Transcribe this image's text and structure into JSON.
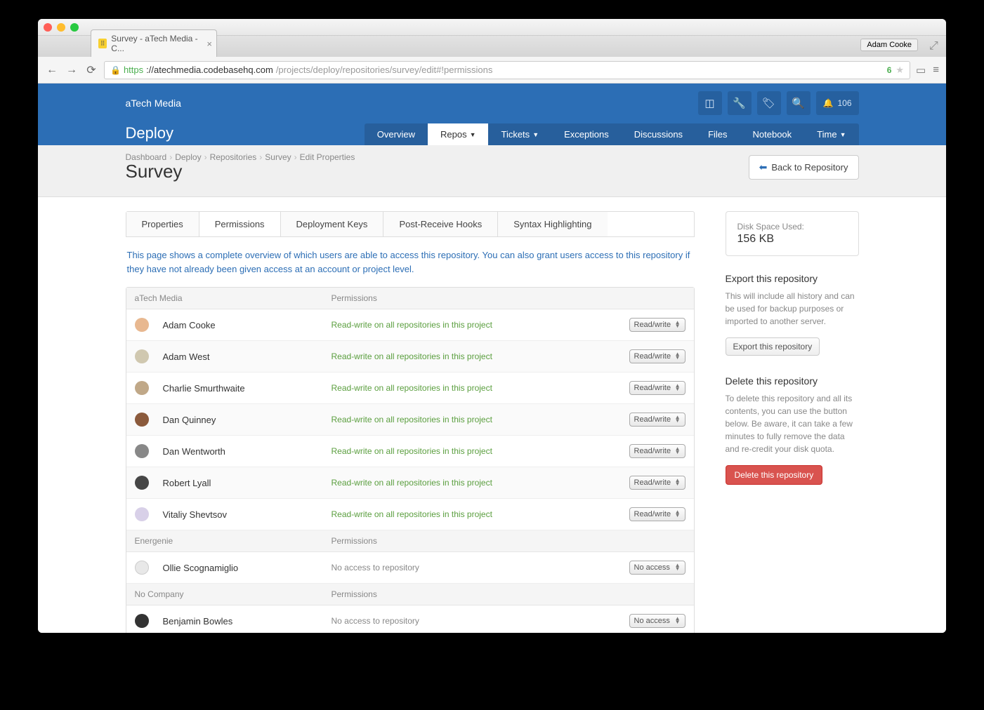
{
  "browser": {
    "tab_title": "Survey - aTech Media - C...",
    "profile": "Adam Cooke",
    "url_scheme": "https",
    "url_host": "://atechmedia.codebasehq.com",
    "url_path": "/projects/deploy/repositories/survey/edit#!permissions",
    "ext_badge": "6"
  },
  "header": {
    "org": "aTech Media",
    "project": "Deploy",
    "notif_count": "106",
    "nav": [
      {
        "label": "Overview"
      },
      {
        "label": "Repos",
        "caret": true,
        "active": true
      },
      {
        "label": "Tickets",
        "caret": true
      },
      {
        "label": "Exceptions"
      },
      {
        "label": "Discussions"
      },
      {
        "label": "Files"
      },
      {
        "label": "Notebook"
      },
      {
        "label": "Time",
        "caret": true
      }
    ]
  },
  "breadcrumbs": [
    "Dashboard",
    "Deploy",
    "Repositories",
    "Survey",
    "Edit Properties"
  ],
  "page_title": "Survey",
  "back_button": "Back to Repository",
  "subtabs": [
    {
      "label": "Properties"
    },
    {
      "label": "Permissions",
      "active": true
    },
    {
      "label": "Deployment Keys"
    },
    {
      "label": "Post-Receive Hooks"
    },
    {
      "label": "Syntax Highlighting"
    }
  ],
  "description": "This page shows a complete overview of which users are able to access this repository. You can also grant users access to this repository if they have not already been given access at an account or project level.",
  "columns": {
    "user": "",
    "perm": "Permissions"
  },
  "groups": [
    {
      "name": "aTech Media",
      "users": [
        {
          "name": "Adam Cooke",
          "perm": "Read-write on all repositories in this project",
          "sel": "Read/write",
          "avatar": "#e8b890"
        },
        {
          "name": "Adam West",
          "perm": "Read-write on all repositories in this project",
          "sel": "Read/write",
          "alt": true,
          "avatar": "#d0c8b0"
        },
        {
          "name": "Charlie Smurthwaite",
          "perm": "Read-write on all repositories in this project",
          "sel": "Read/write",
          "avatar": "#c0a888"
        },
        {
          "name": "Dan Quinney",
          "perm": "Read-write on all repositories in this project",
          "sel": "Read/write",
          "alt": true,
          "avatar": "#8b5a3c"
        },
        {
          "name": "Dan Wentworth",
          "perm": "Read-write on all repositories in this project",
          "sel": "Read/write",
          "avatar": "#888"
        },
        {
          "name": "Robert Lyall",
          "perm": "Read-write on all repositories in this project",
          "sel": "Read/write",
          "alt": true,
          "avatar": "#464646"
        },
        {
          "name": "Vitaliy Shevtsov",
          "perm": "Read-write on all repositories in this project",
          "sel": "Read/write",
          "avatar": "#d8d0e8"
        }
      ]
    },
    {
      "name": "Energenie",
      "users": [
        {
          "name": "Ollie Scognamiglio",
          "perm": "No access to repository",
          "sel": "No access",
          "gray": true,
          "empty": true
        }
      ]
    },
    {
      "name": "No Company",
      "users": [
        {
          "name": "Benjamin Bowles",
          "perm": "No access to repository",
          "sel": "No access",
          "gray": true,
          "avatar": "#333"
        }
      ]
    }
  ],
  "sidebar": {
    "disk_label": "Disk Space Used:",
    "disk_value": "156 KB",
    "export_title": "Export this repository",
    "export_text": "This will include all history and can be used for backup purposes or imported to another server.",
    "export_button": "Export this repository",
    "delete_title": "Delete this repository",
    "delete_text": "To delete this repository and all its contents, you can use the button below. Be aware, it can take a few minutes to fully remove the data and re-credit your disk quota.",
    "delete_button": "Delete this repository"
  }
}
